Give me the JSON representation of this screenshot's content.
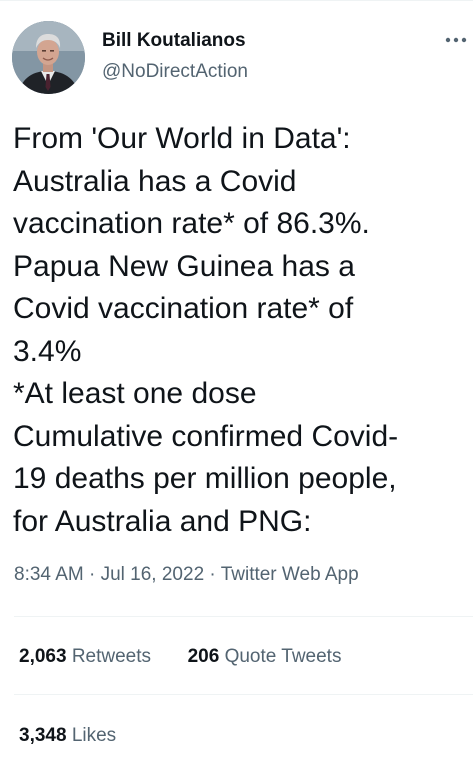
{
  "author": {
    "name": "Bill Koutalianos",
    "handle": "@NoDirectAction"
  },
  "tweet": {
    "lines": [
      "From 'Our World in Data':",
      "Australia has a Covid",
      "vaccination rate* of 86.3%.",
      "Papua New Guinea has a",
      "Covid vaccination rate* of",
      "3.4%",
      "*At least one dose",
      "Cumulative confirmed Covid-",
      "19 deaths per million people,",
      "for Australia and PNG:"
    ]
  },
  "meta": {
    "time": "8:34 AM",
    "sep1": " · ",
    "date": "Jul 16, 2022",
    "sep2": " · ",
    "source": "Twitter Web App"
  },
  "stats": {
    "retweets": {
      "count": "2,063",
      "label": "Retweets"
    },
    "quote_tweets": {
      "count": "206",
      "label": "Quote Tweets"
    },
    "likes": {
      "count": "3,348",
      "label": "Likes"
    }
  },
  "icons": {
    "more": "more-horizontal-icon"
  },
  "colors": {
    "text": "#0f1419",
    "secondary": "#536471",
    "divider": "#eff3f4"
  }
}
